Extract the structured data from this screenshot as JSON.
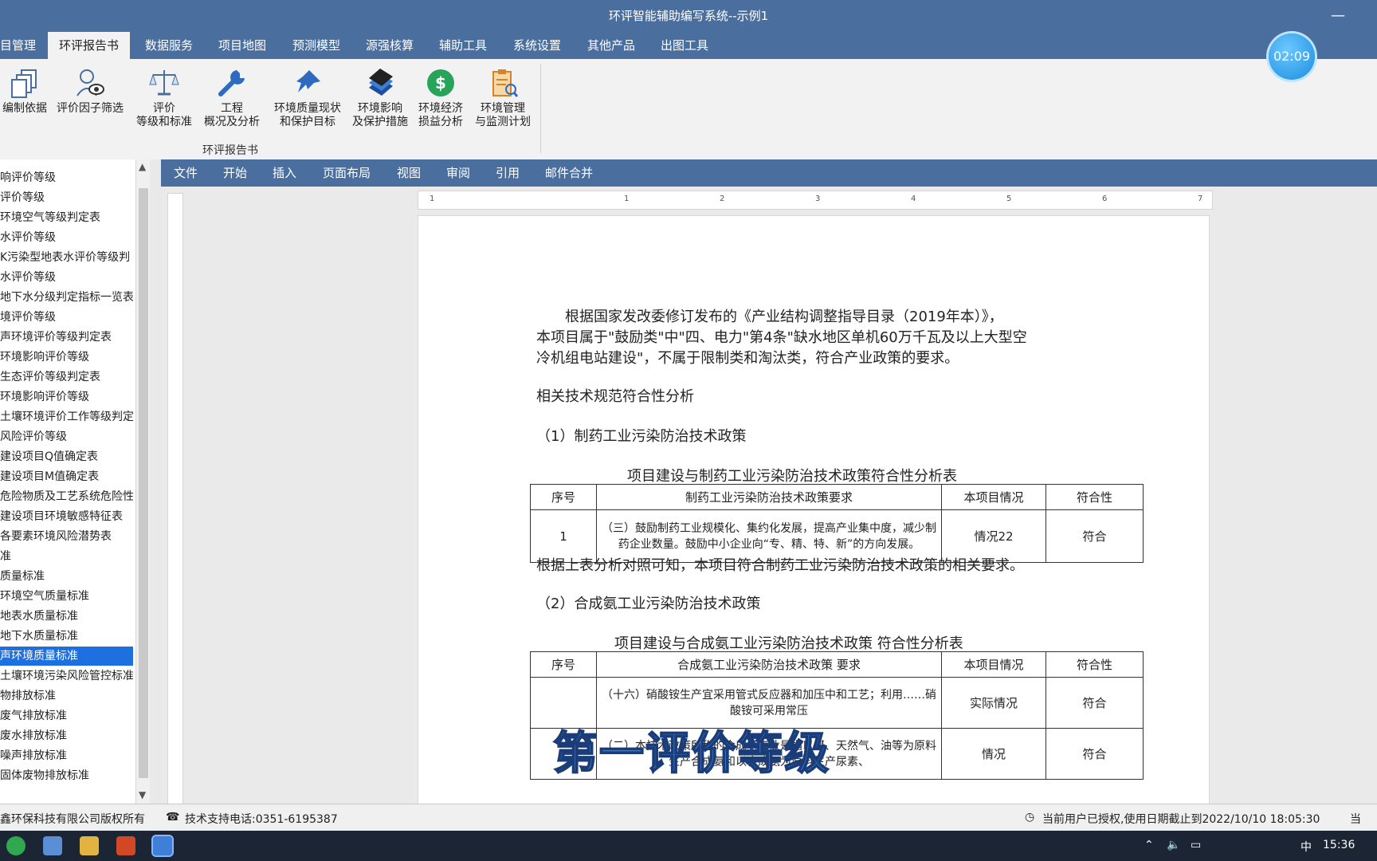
{
  "window": {
    "title": "环评智能辅助编写系统--示例1",
    "minimize_symbol": "—",
    "timer": "02:09"
  },
  "menu": {
    "items": [
      "目管理",
      "环评报告书",
      "数据服务",
      "项目地图",
      "预测模型",
      "源强核算",
      "辅助工具",
      "系统设置",
      "其他产品",
      "出图工具"
    ],
    "active_index": 1
  },
  "ribbon": {
    "buttons": [
      {
        "label": "编制依据",
        "icon": "documents-icon"
      },
      {
        "label": "评价因子筛选",
        "icon": "person-eye-icon"
      },
      {
        "label": "评价\n等级和标准",
        "icon": "scale-icon"
      },
      {
        "label": "工程\n概况及分析",
        "icon": "wrench-icon"
      },
      {
        "label": "环境质量现状\n和保护目标",
        "icon": "pin-icon"
      },
      {
        "label": "环境影响\n及保护措施",
        "icon": "book-icon"
      },
      {
        "label": "环境经济\n损益分析",
        "icon": "dollar-icon"
      },
      {
        "label": "环境管理\n与监测计划",
        "icon": "clipboard-icon"
      }
    ],
    "group_label": "环评报告书"
  },
  "tree": {
    "items": [
      "响评价等级",
      "评价等级",
      "环境空气等级判定表",
      "水评价等级",
      "K污染型地表水评价等级判",
      "水评价等级",
      "地下水分级判定指标一览表",
      "境评价等级",
      "声环境评价等级判定表",
      "环境影响评价等级",
      "生态评价等级判定表",
      "环境影响评价等级",
      "土壤环境评价工作等级判定",
      "风险评价等级",
      "建设项目Q值确定表",
      "建设项目M值确定表",
      "危险物质及工艺系统危险性",
      "建设项目环境敏感特征表",
      "各要素环境风险潜势表",
      "准",
      "质量标准",
      "环境空气质量标准",
      "地表水质量标准",
      "地下水质量标准",
      "声环境质量标准",
      "土壤环境污染风险管控标准",
      "物排放标准",
      "废气排放标准",
      "废水排放标准",
      "噪声排放标准",
      "固体废物排放标准"
    ],
    "selected_index": 24
  },
  "word_menu": [
    "文件",
    "开始",
    "插入",
    "页面布局",
    "视图",
    "审阅",
    "引用",
    "邮件合并"
  ],
  "ruler_numbers": [
    "1",
    "1",
    "2",
    "3",
    "4",
    "5",
    "6",
    "7"
  ],
  "document": {
    "para1": [
      "根据国家发改委修订发布的《产业结构调整指导目录（2019年本）》，",
      "本项目属于\"鼓励类\"中\"四、电力\"第4条\"缺水地区单机60万千瓦及以上大型空",
      "冷机组电站建设\"，不属于限制类和淘汰类，符合产业政策的要求。"
    ],
    "heading": "相关技术规范符合性分析",
    "sub1": "（1）制药工业污染防治技术政策",
    "table1": {
      "caption": "项目建设与制药工业污染防治技术政策符合性分析表",
      "headers": [
        "序号",
        "制药工业污染防治技术政策要求",
        "本项目情况",
        "符合性"
      ],
      "rows": [
        [
          "1",
          "（三）鼓励制药工业规模化、集约化发展，提高产业集中度，减少制药企业数量。鼓励中小企业向“专、精、特、新”的方向发展。",
          "情况22",
          "符合"
        ]
      ]
    },
    "conclusion1": "根据上表分析对照可知，本项目符合制药工业污染防治技术政策的相关要求。",
    "sub2": "（2）合成氨工业污染防治技术政策",
    "table2": {
      "caption": "项目建设与合成氨工业污染防治技术政策 符合性分析表",
      "headers": [
        "序号",
        "合成氨工业污染防治技术政策 要求",
        "本项目情况",
        "符合性"
      ],
      "rows": [
        [
          "",
          "（十六）硝酸铵生产宜采用管式反应器和加压中和工艺；利用……硝酸铵可采用常压",
          "实际情况",
          "符合"
        ],
        [
          "2",
          "（二）本技术政策所称的合成氨工业是指以煤、天然气、油等为原料生产合成氨和以合成氨为原料生产尿素、",
          "情况",
          "符合"
        ]
      ]
    }
  },
  "overlay_caption": "第一评价等级",
  "status": {
    "copyright": "鑫环保科技有限公司版权所有",
    "phone": "技术支持电话:0351-6195387",
    "license": "当前用户已授权,使用日期截止到2022/10/10 18:05:30",
    "right_cut": "当"
  },
  "taskbar": {
    "time": "15:36",
    "ime": "中"
  },
  "colors": {
    "title_blue": "#4a6f9e",
    "selection_blue": "#1e6fe0",
    "overlay_text": "#4aa3ff"
  }
}
